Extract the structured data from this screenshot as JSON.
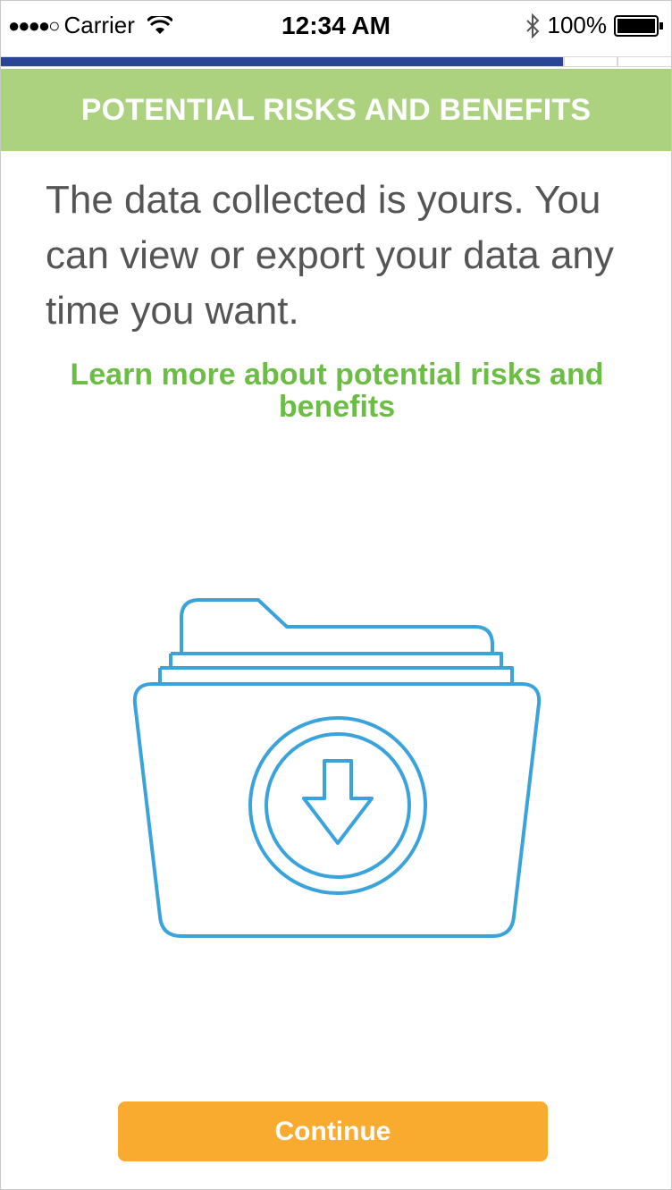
{
  "status_bar": {
    "signal": "●●●●○",
    "carrier": "Carrier",
    "time": "12:34 AM",
    "battery": "100%",
    "icons": [
      "wifi-icon",
      "bluetooth-icon",
      "battery-icon"
    ]
  },
  "progress": {
    "fraction": 0.84,
    "segments": 3
  },
  "header": {
    "title": "POTENTIAL RISKS AND BENEFITS"
  },
  "content": {
    "body": "The data collected is yours. You can view or export your data any time you want.",
    "learn_more": "Learn more about potential risks and benefits",
    "illustration_icon": "folder-download-icon"
  },
  "actions": {
    "continue_label": "Continue"
  },
  "colors": {
    "header_bg": "#acd280",
    "progress_fill": "#2b4595",
    "link": "#6cbd45",
    "button": "#f9ab30",
    "illustration_stroke": "#3ba3dc",
    "body_text": "#555555"
  }
}
